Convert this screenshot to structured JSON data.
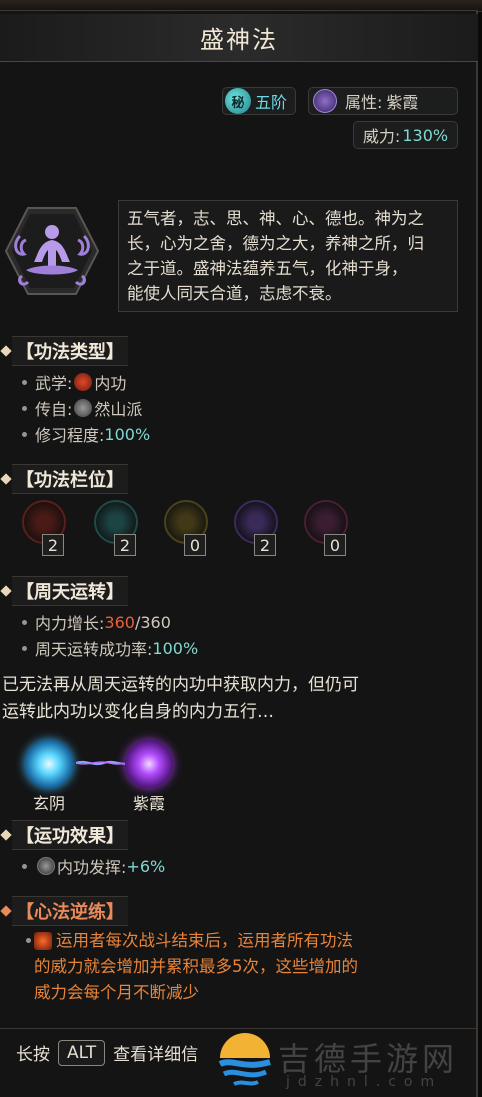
{
  "title": "盛神法",
  "tags": {
    "rank_badge": "秘",
    "rank": "五阶",
    "attribute_label": "属性:",
    "attribute_value": "紫霞",
    "power_label": "威力:",
    "power_value": "130%"
  },
  "description": {
    "lines": [
      "五气者，志、思、神、心、德也。神为之",
      "长，心为之舍，德为之大，养神之所，归",
      "之于道。盛神法蕴养五气，化神于身，",
      "能使人同天合道，志虑不衰。"
    ]
  },
  "sections": {
    "type": {
      "title": "【功法类型】",
      "martial_label": "武学:",
      "martial_value": "内功",
      "origin_label": "传自:",
      "origin_value": "然山派",
      "progress_label": "修习程度:",
      "progress_value": "100%"
    },
    "slots": {
      "title": "【功法栏位】",
      "values": [
        "2",
        "2",
        "0",
        "2",
        "0"
      ],
      "colors": [
        "#c0392b",
        "#2f8f8a",
        "#b8a030",
        "#8f6ad0",
        "#a0506a"
      ]
    },
    "cycle": {
      "title": "【周天运转】",
      "growth_label": "内力增长:",
      "growth_current": "360",
      "growth_sep": "/360",
      "rate_label": "周天运转成功率:",
      "rate_value": "100%"
    },
    "note": {
      "line1": "已无法再从周天运转的内功中获取内力，但仍可",
      "line2": "运转此内功以变化自身的内力五行…"
    },
    "elements": {
      "from": "玄阴",
      "to": "紫霞"
    },
    "effect": {
      "title": "【运功效果】",
      "label": "内功发挥:",
      "value": "+6%"
    },
    "reverse": {
      "title": "【心法逆练】",
      "line1": "运用者每次战斗结束后，运用者所有功法",
      "line2": "的威力就会增加并累积最多5次，这些增加的",
      "line3": "威力会每个月不断减少"
    }
  },
  "footer": {
    "prefix": "长按",
    "key": "ALT",
    "suffix": "查看详细信"
  },
  "watermark": {
    "text": "吉德手游网",
    "url": "jdzhnl.com"
  },
  "colors": {
    "accent_cyan": "#7fd8d2",
    "warning_orange": "#e8843a",
    "red": "#e8613a"
  }
}
